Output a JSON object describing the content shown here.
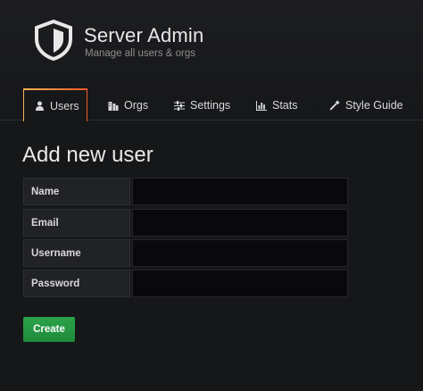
{
  "header": {
    "title": "Server Admin",
    "subtitle": "Manage all users & orgs",
    "logo_icon": "shield-icon"
  },
  "tabs": [
    {
      "label": "Users",
      "icon": "user-icon",
      "active": true
    },
    {
      "label": "Orgs",
      "icon": "building-icon",
      "active": false
    },
    {
      "label": "Settings",
      "icon": "sliders-icon",
      "active": false
    },
    {
      "label": "Stats",
      "icon": "bar-chart-icon",
      "active": false
    },
    {
      "label": "Style Guide",
      "icon": "eyedropper-icon",
      "active": false
    }
  ],
  "main": {
    "title": "Add new user",
    "fields": [
      {
        "label": "Name",
        "value": ""
      },
      {
        "label": "Email",
        "value": ""
      },
      {
        "label": "Username",
        "value": ""
      },
      {
        "label": "Password",
        "value": ""
      }
    ],
    "create_label": "Create"
  },
  "colors": {
    "background": "#161719",
    "accent_gradient_start": "#ffb357",
    "accent_gradient_end": "#f05a28",
    "button_green": "#2ba34a",
    "input_background": "#09090b"
  }
}
